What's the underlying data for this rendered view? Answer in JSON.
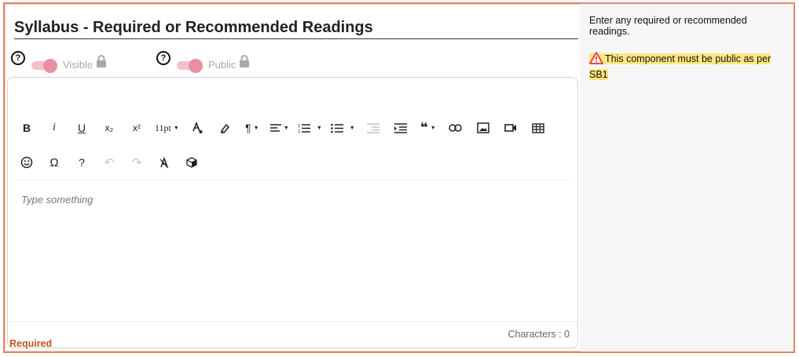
{
  "section": {
    "title": "Syllabus - Required or Recommended Readings",
    "required_label": "Required"
  },
  "toggles": [
    {
      "label": "Visible",
      "state": "on",
      "locked": true
    },
    {
      "label": "Public",
      "state": "on",
      "locked": true
    }
  ],
  "editor": {
    "toolbar_row1": [
      {
        "name": "bold-button",
        "label": "B"
      },
      {
        "name": "italic-button",
        "label": "i"
      },
      {
        "name": "underline-button",
        "label": "U"
      },
      {
        "name": "subscript-button",
        "label": "x₂"
      },
      {
        "name": "superscript-button",
        "label": "x²"
      },
      {
        "name": "font-size-dropdown",
        "label": "11pt"
      }
    ],
    "placeholder": "Type something",
    "characters_label": "Characters : 0"
  },
  "sidebar": {
    "help_text": "Enter any required or recommended readings.",
    "warning_text": "This component must be public as per SB1",
    "warning_color": "#ffe680"
  },
  "colors": {
    "border_accent": "#e0866a",
    "toggle_knob": "#e98fa1",
    "required": "#c0531f"
  }
}
